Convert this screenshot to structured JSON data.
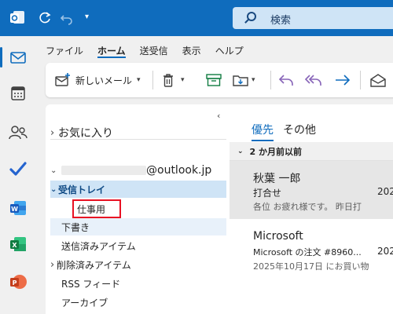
{
  "titlebar": {
    "search_placeholder": "検索"
  },
  "menu": {
    "file": "ファイル",
    "home": "ホーム",
    "send_receive": "送受信",
    "view": "表示",
    "help": "ヘルプ"
  },
  "toolbar": {
    "new_mail": "新しいメール"
  },
  "folders": {
    "favorites": "お気に入り",
    "account_email": "@outlook.jp",
    "inbox": "受信トレイ",
    "new_folder_name": "仕事用",
    "drafts": "下書き",
    "sent": "送信済みアイテム",
    "deleted": "削除済みアイテム",
    "rss": "RSS フィード",
    "archive": "アーカイブ"
  },
  "messagelist": {
    "tab_focused": "優先",
    "tab_other": "その他",
    "group_label": "2 か月前以前",
    "messages": [
      {
        "sender": "秋葉 一郎",
        "subject": "打合せ",
        "date": "202",
        "preview": "各位 お疲れ様です。 昨日打"
      },
      {
        "sender": "Microsoft",
        "subject": "Microsoft の注文 #8960...",
        "date": "202",
        "preview": "2025年10月17日 にお買い物"
      }
    ]
  },
  "colors": {
    "brand": "#0f6cbd",
    "selection": "#cfe4f6",
    "red_outline": "#e81123"
  }
}
